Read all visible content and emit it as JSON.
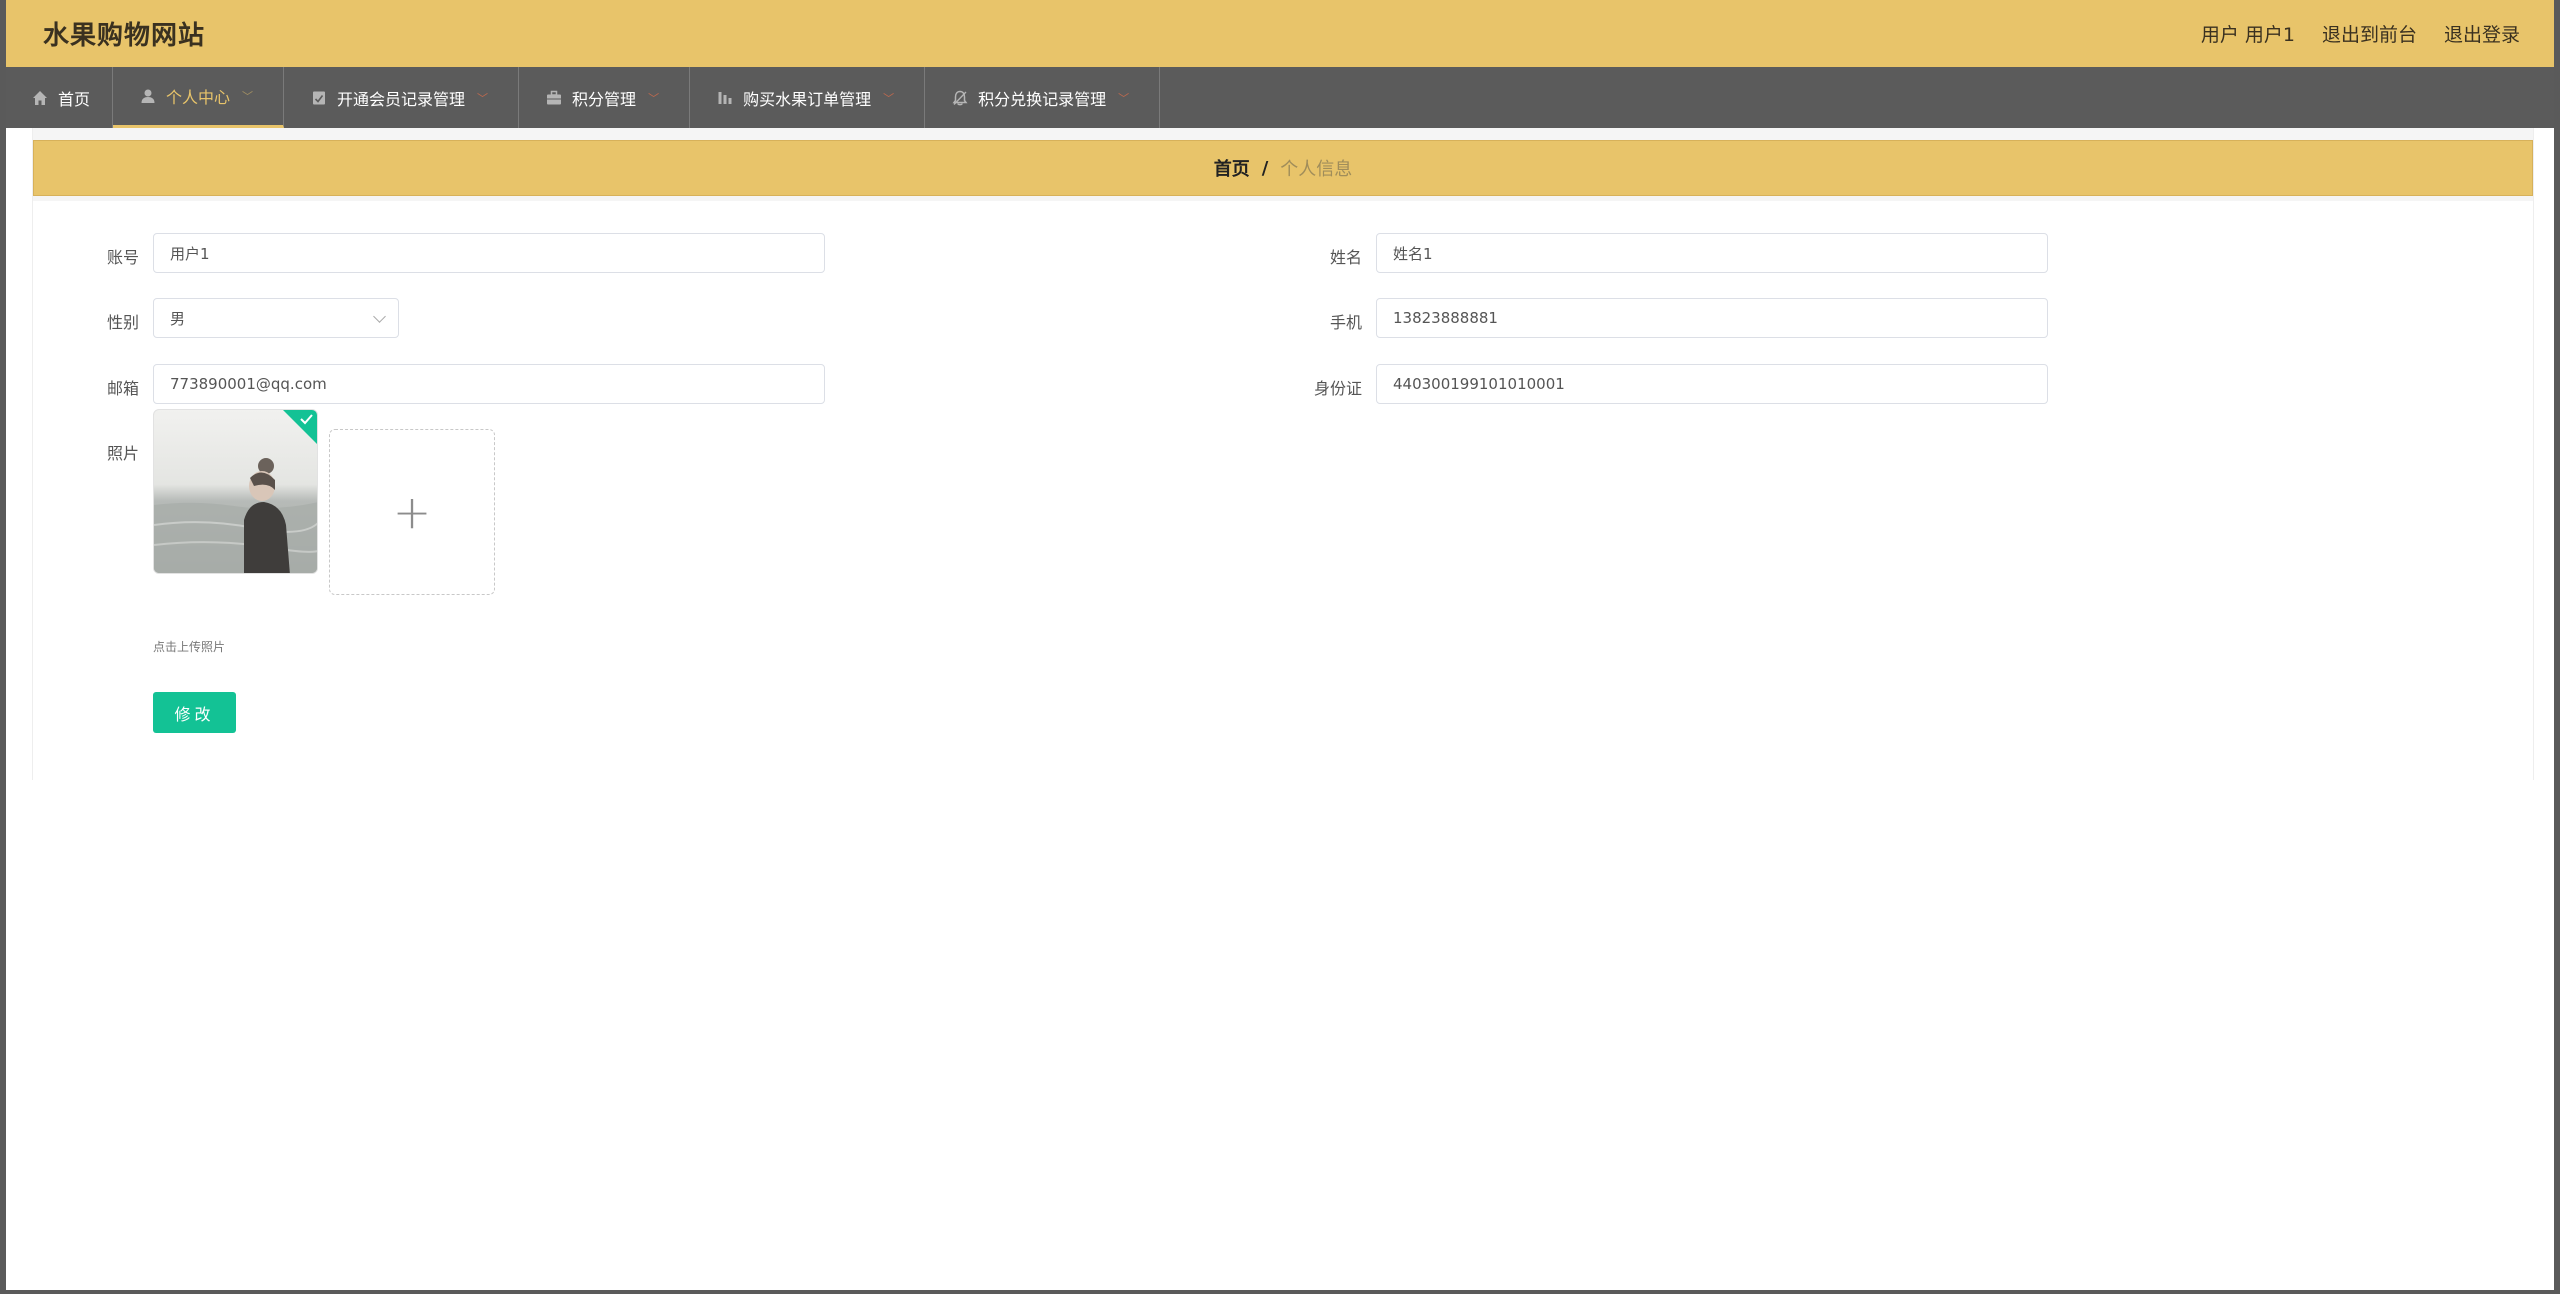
{
  "header": {
    "site_title": "水果购物网站",
    "user_label": "用户 用户1",
    "front_link": "退出到前台",
    "logout_link": "退出登录"
  },
  "nav": {
    "items": [
      {
        "label": "首页",
        "icon": "home-icon"
      },
      {
        "label": "个人中心",
        "icon": "user-icon",
        "active": true
      },
      {
        "label": "开通会员记录管理",
        "icon": "document-icon"
      },
      {
        "label": "积分管理",
        "icon": "briefcase-icon"
      },
      {
        "label": "购买水果订单管理",
        "icon": "chart-icon"
      },
      {
        "label": "积分兑换记录管理",
        "icon": "bell-icon"
      }
    ]
  },
  "breadcrumb": {
    "home": "首页",
    "separator": "/",
    "current": "个人信息"
  },
  "form": {
    "account_label": "账号",
    "account_value": "用户1",
    "name_label": "姓名",
    "name_value": "姓名1",
    "gender_label": "性别",
    "gender_value": "男",
    "phone_label": "手机",
    "phone_value": "13823888881",
    "email_label": "邮箱",
    "email_value": "773890001@qq.com",
    "idcard_label": "身份证",
    "idcard_value": "440300199101010001",
    "photo_label": "照片",
    "upload_tip": "点击上传照片",
    "submit_label": "修改"
  },
  "colors": {
    "header_bg": "#e8c46a",
    "nav_bg": "#5b5b5b",
    "active_nav": "#e8c46a",
    "submit_bg": "#13c295"
  }
}
